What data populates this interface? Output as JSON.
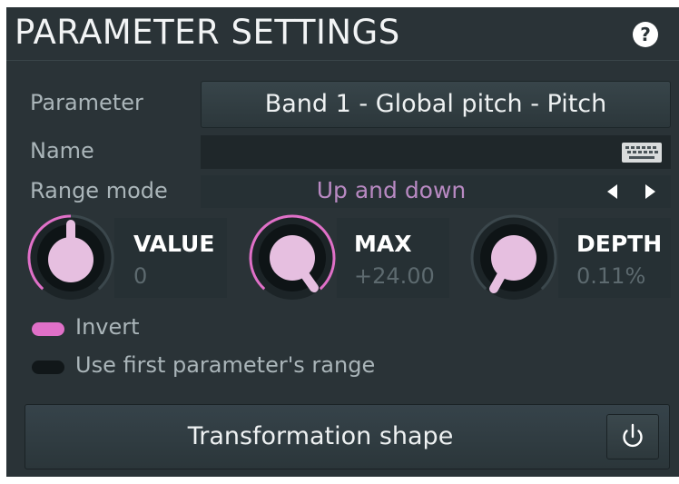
{
  "header": {
    "title": "PARAMETER SETTINGS",
    "help_symbol": "?"
  },
  "parameter": {
    "label": "Parameter",
    "value": "Band 1 - Global pitch - Pitch"
  },
  "name": {
    "label": "Name",
    "value": "",
    "icon": "keyboard-icon"
  },
  "range_mode": {
    "label": "Range mode",
    "value": "Up and down"
  },
  "knobs": [
    {
      "name": "VALUE",
      "value": "0",
      "level": 0.5
    },
    {
      "name": "MAX",
      "value": "+24.00",
      "level": 1.0
    },
    {
      "name": "DEPTH",
      "value": "0.11%",
      "level": 0.0011
    }
  ],
  "options": {
    "invert": {
      "label": "Invert",
      "on": true
    },
    "use_first_range": {
      "label": "Use first parameter's range",
      "on": false
    }
  },
  "footer": {
    "shape_label": "Transformation shape",
    "power_icon": "power-icon"
  },
  "colors": {
    "background": "#2a3337",
    "accent": "#e070c8",
    "knob_face": "#e6bfe0",
    "range_text": "#b889c2"
  }
}
